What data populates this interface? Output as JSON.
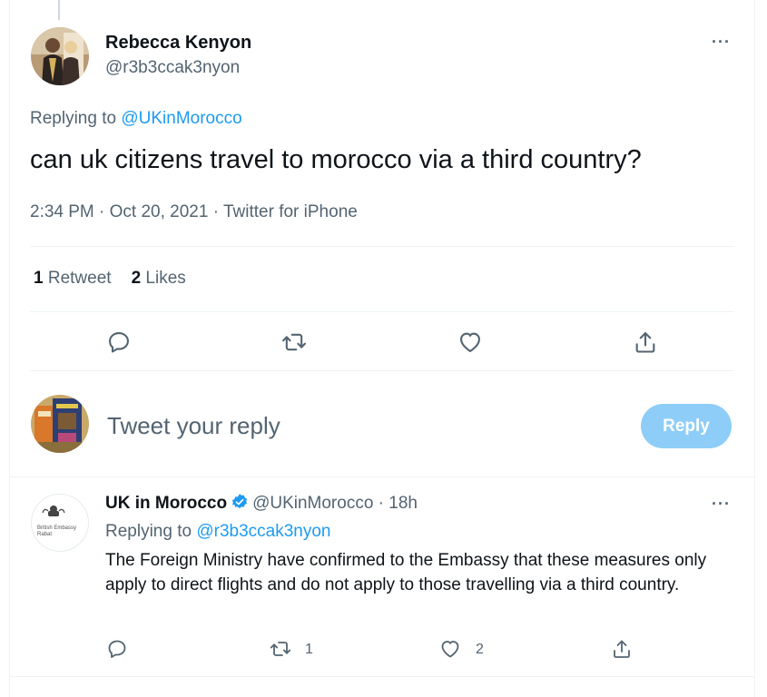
{
  "tweet": {
    "author_name": "Rebecca Kenyon",
    "author_handle": "@r3b3ccak3nyon",
    "replying_prefix": "Replying to ",
    "replying_to": "@UKinMorocco",
    "text": "can uk citizens travel to morocco via a third country?",
    "meta": "2:34 PM · Oct 20, 2021 · Twitter for iPhone",
    "retweet_count": "1",
    "retweet_label": "Retweet",
    "like_count": "2",
    "like_label": "Likes",
    "more": "···"
  },
  "composer": {
    "placeholder": "Tweet your reply",
    "button_label": "Reply"
  },
  "reply": {
    "author_name": "UK in Morocco",
    "author_handle": "@UKinMorocco",
    "separator": " · ",
    "time": "18h",
    "replying_prefix": "Replying to ",
    "replying_to": "@r3b3ccak3nyon",
    "text": "The Foreign Ministry have confirmed to the Embassy that these measures only apply to direct flights and do not apply to those travelling via a third country.",
    "retweet_count": "1",
    "like_count": "2",
    "more": "···",
    "avatar_text_line1": "British Embassy",
    "avatar_text_line2": "Rabat"
  },
  "icons": {
    "reply": "reply-icon",
    "retweet": "retweet-icon",
    "like": "heart-icon",
    "share": "share-icon",
    "verified": "verified-badge-icon",
    "more": "more-icon"
  },
  "colors": {
    "accent": "#1d9bf0",
    "reply_button_disabled": "#8ecdf7",
    "secondary_text": "#536471",
    "primary_text": "#0f1419"
  }
}
